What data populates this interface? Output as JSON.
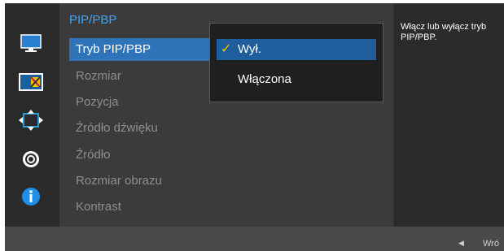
{
  "menu": {
    "title": "PIP/PBP",
    "items": [
      {
        "label": "Tryb PIP/PBP"
      },
      {
        "label": "Rozmiar"
      },
      {
        "label": "Pozycja"
      },
      {
        "label": "Źródło dźwięku"
      },
      {
        "label": "Źródło"
      },
      {
        "label": "Rozmiar obrazu"
      },
      {
        "label": "Kontrast"
      }
    ]
  },
  "submenu": {
    "options": [
      {
        "label": "Wył.",
        "checkmark": "✓"
      },
      {
        "label": "Włączona"
      }
    ]
  },
  "help": {
    "text": "Włącz lub wyłącz tryb PIP/PBP."
  },
  "bottom": {
    "back_label": "Wró"
  },
  "sidebar_icons": [
    "monitor-icon",
    "picture-icon",
    "move-icon",
    "settings-icon",
    "info-icon"
  ],
  "colors": {
    "accent": "#2f74b9",
    "title": "#3fa5ff",
    "check": "#f5c400"
  }
}
